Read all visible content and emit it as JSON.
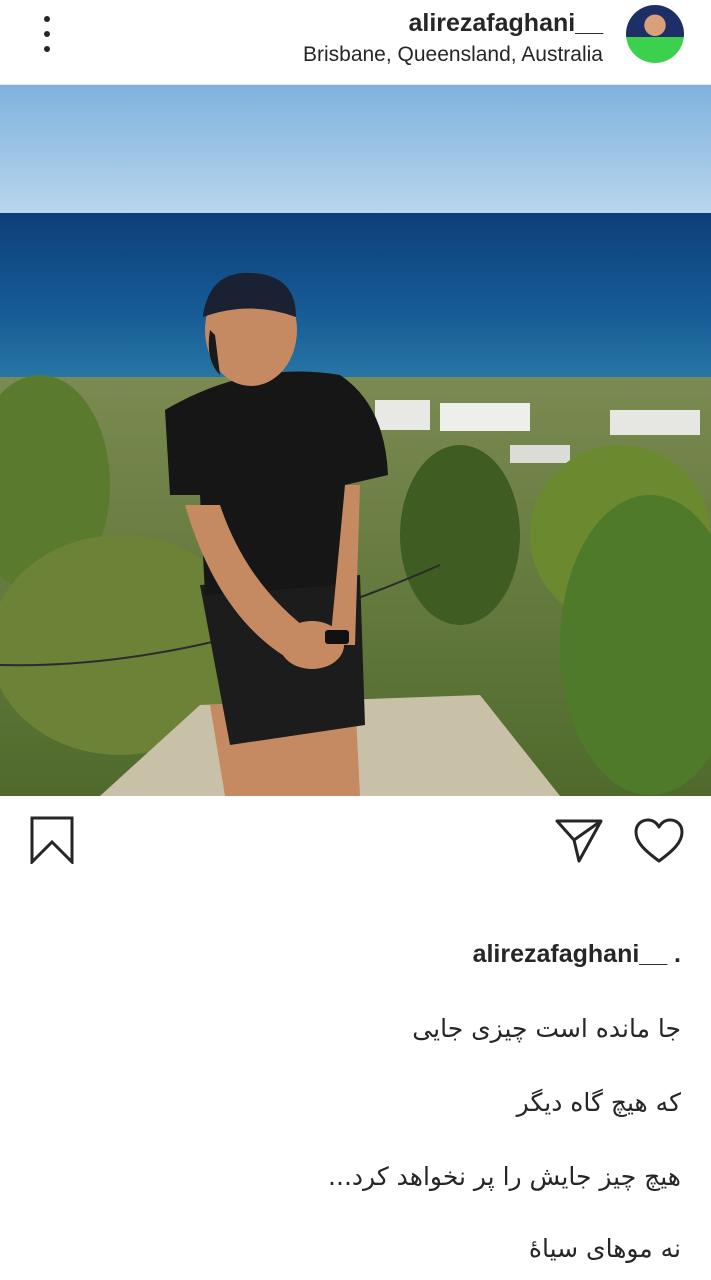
{
  "header": {
    "username": "alirezafaghani__",
    "location": "Brisbane, Queensland, Australia",
    "menu_icon": "vertical-ellipsis-icon",
    "avatar_icon": "profile-avatar"
  },
  "post": {
    "image_subject": "photo",
    "actions": {
      "bookmark_icon": "bookmark-icon",
      "share_icon": "send-icon",
      "like_icon": "heart-icon"
    }
  },
  "caption": {
    "username": "alirezafaghani__ .",
    "lines": [
      "جا مانده است چیزی جایی",
      "که هیچ گاه دیگر",
      "هیچ چیز جایش را پر نخواهد کرد...",
      "نه موهای سیاهٔ"
    ]
  }
}
